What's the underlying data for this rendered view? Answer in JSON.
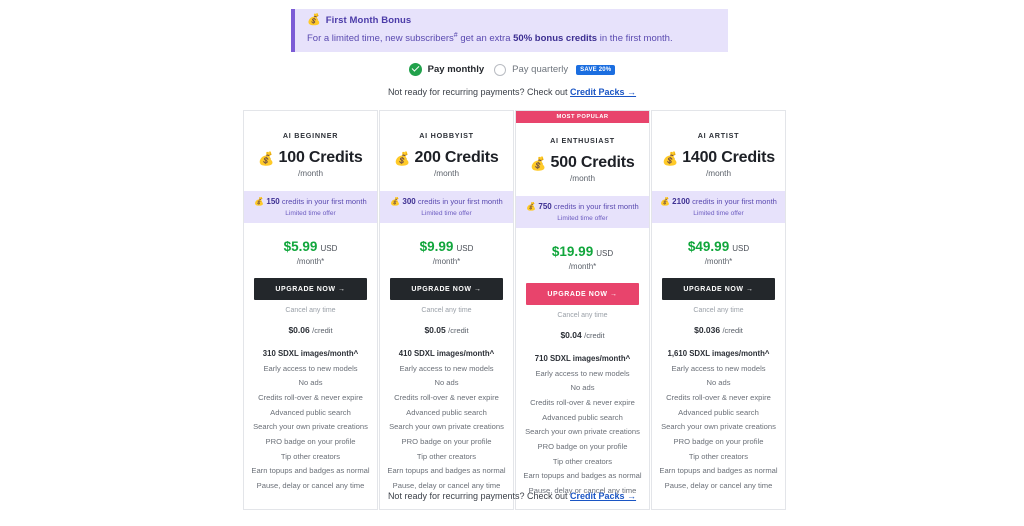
{
  "bonus_banner": {
    "icon": "money-bag-emoji",
    "title": "First Month Bonus",
    "text_before": "For a limited time, new subscribers",
    "superscript": "#",
    "text_middle": " get an extra ",
    "highlight": "50% bonus credits",
    "text_after": " in the first month."
  },
  "billing": {
    "monthly_label": "Pay monthly",
    "quarterly_label": "Pay quarterly",
    "save_badge": "SAVE 20%",
    "selected": "monthly"
  },
  "packs_note": {
    "text": "Not ready for recurring payments? Check out ",
    "link": "Credit Packs →"
  },
  "cards": [
    {
      "ribbon": "",
      "plan": "AI BEGINNER",
      "credits": "100 Credits",
      "period": "/month",
      "bonus_credits": "150",
      "bonus_text": " credits in your first month",
      "bonus_sub": "Limited time offer",
      "price": "$5.99",
      "currency": "USD",
      "price_period": "/month*",
      "cta": "UPGRADE NOW →",
      "cancel": "Cancel any time",
      "per_credit_value": "$0.06",
      "per_credit_unit": "/credit",
      "features": [
        "310 SDXL images/month^",
        "Early access to new models",
        "No ads",
        "Credits roll-over & never expire",
        "Advanced public search",
        "Search your own private creations",
        "PRO badge on your profile",
        "Tip other creators",
        "Earn topups and badges as normal",
        "Pause, delay or cancel any time"
      ]
    },
    {
      "ribbon": "",
      "plan": "AI HOBBYIST",
      "credits": "200 Credits",
      "period": "/month",
      "bonus_credits": "300",
      "bonus_text": " credits in your first month",
      "bonus_sub": "Limited time offer",
      "price": "$9.99",
      "currency": "USD",
      "price_period": "/month*",
      "cta": "UPGRADE NOW →",
      "cancel": "Cancel any time",
      "per_credit_value": "$0.05",
      "per_credit_unit": "/credit",
      "features": [
        "410 SDXL images/month^",
        "Early access to new models",
        "No ads",
        "Credits roll-over & never expire",
        "Advanced public search",
        "Search your own private creations",
        "PRO badge on your profile",
        "Tip other creators",
        "Earn topups and badges as normal",
        "Pause, delay or cancel any time"
      ]
    },
    {
      "ribbon": "MOST POPULAR",
      "plan": "AI ENTHUSIAST",
      "credits": "500 Credits",
      "period": "/month",
      "bonus_credits": "750",
      "bonus_text": " credits in your first month",
      "bonus_sub": "Limited time offer",
      "price": "$19.99",
      "currency": "USD",
      "price_period": "/month*",
      "cta": "UPGRADE NOW →",
      "cancel": "Cancel any time",
      "per_credit_value": "$0.04",
      "per_credit_unit": "/credit",
      "features": [
        "710 SDXL images/month^",
        "Early access to new models",
        "No ads",
        "Credits roll-over & never expire",
        "Advanced public search",
        "Search your own private creations",
        "PRO badge on your profile",
        "Tip other creators",
        "Earn topups and badges as normal",
        "Pause, delay or cancel any time"
      ]
    },
    {
      "ribbon": "",
      "plan": "AI ARTIST",
      "credits": "1400 Credits",
      "period": "/month",
      "bonus_credits": "2100",
      "bonus_text": " credits in your first month",
      "bonus_sub": "Limited time offer",
      "price": "$49.99",
      "currency": "USD",
      "price_period": "/month*",
      "cta": "UPGRADE NOW →",
      "cancel": "Cancel any time",
      "per_credit_value": "$0.036",
      "per_credit_unit": "/credit",
      "features": [
        "1,610 SDXL images/month^",
        "Early access to new models",
        "No ads",
        "Credits roll-over & never expire",
        "Advanced public search",
        "Search your own private creations",
        "PRO badge on your profile",
        "Tip other creators",
        "Earn topups and badges as normal",
        "Pause, delay or cancel any time"
      ]
    }
  ],
  "colors": {
    "accent_pink": "#e8446c",
    "price_green": "#11a63c",
    "bonus_lavender": "#e7e2fb",
    "bonus_purple": "#7c5cd6",
    "link_blue": "#1a55c4",
    "badge_blue": "#1b6ee0",
    "cta_dark": "#23272b"
  }
}
